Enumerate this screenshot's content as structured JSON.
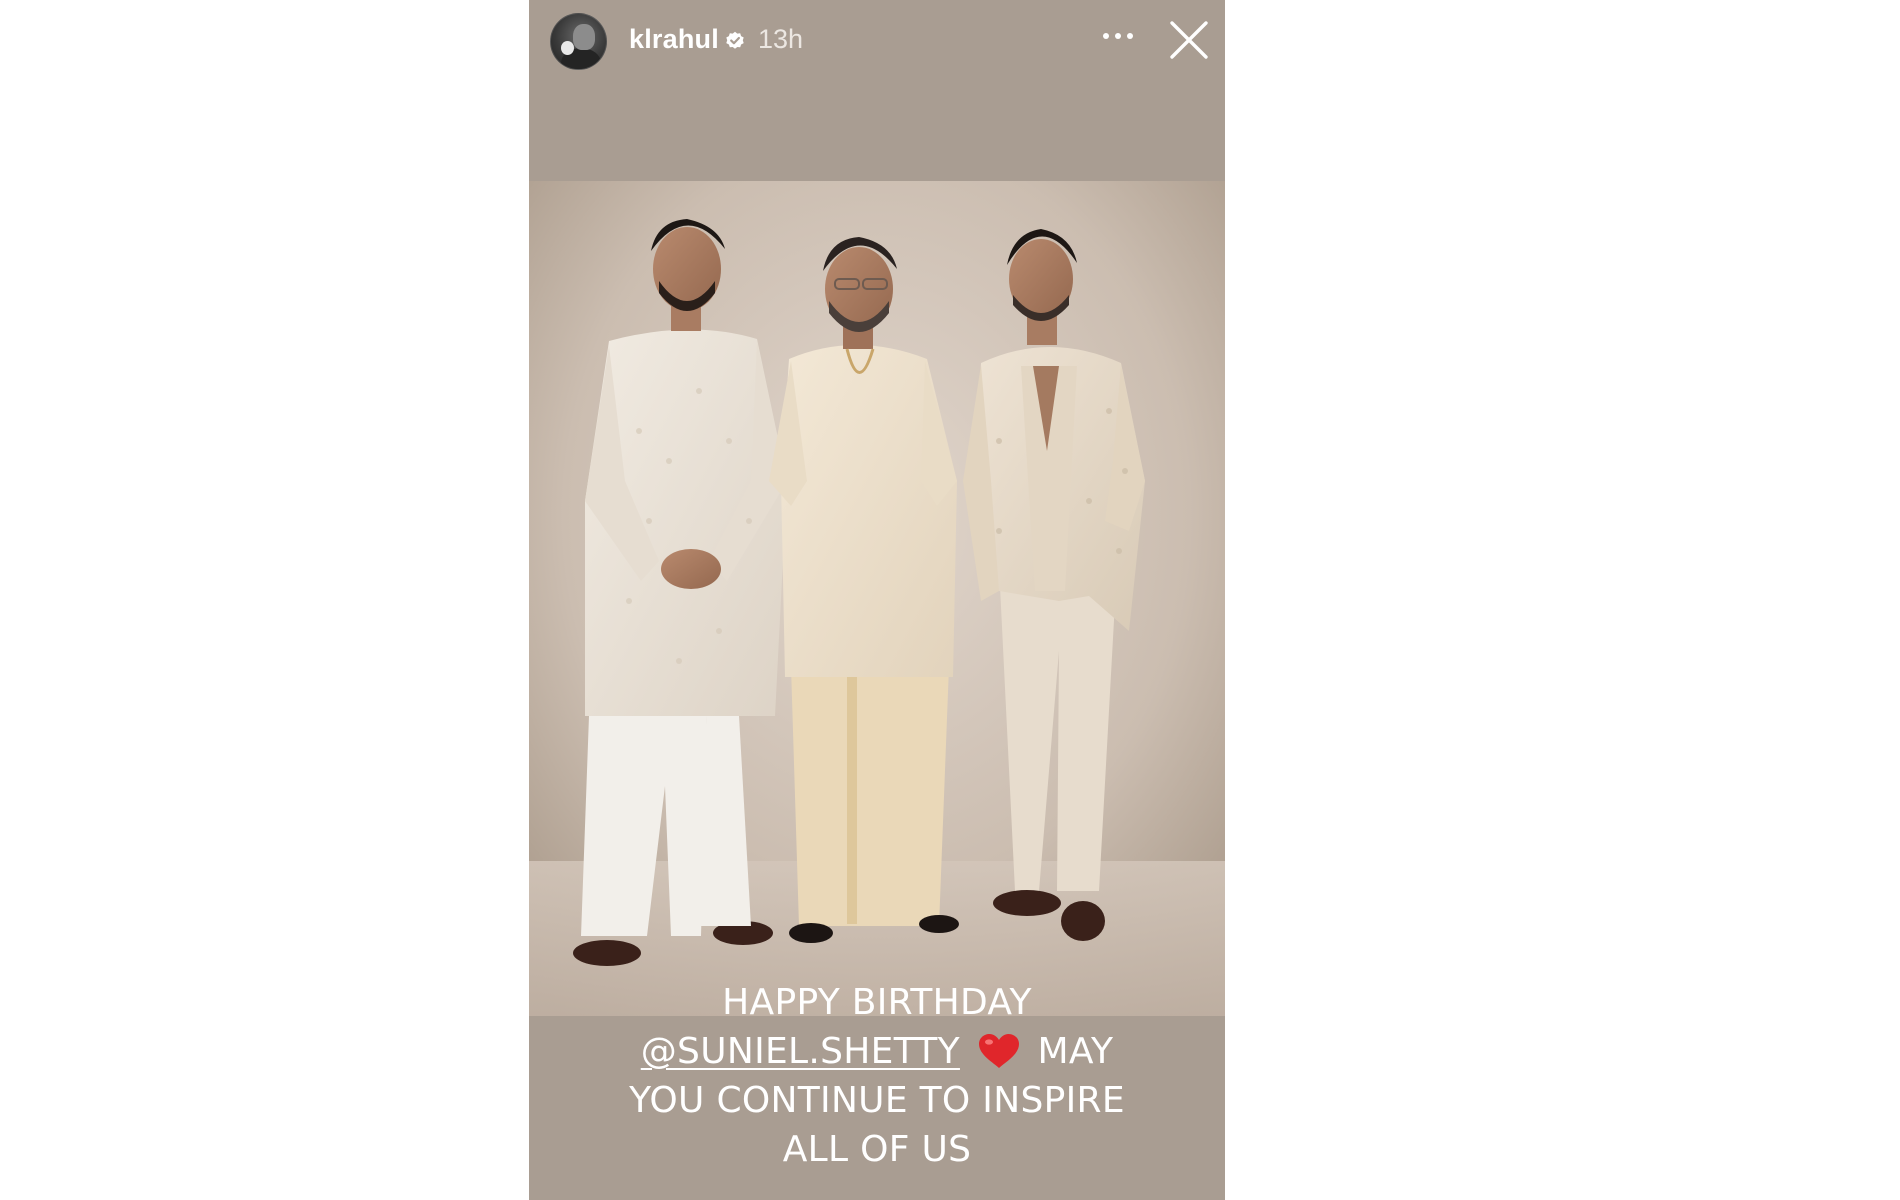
{
  "story": {
    "username": "klrahul",
    "verified": true,
    "timestamp": "13h",
    "icons": {
      "verified": "verified-badge-icon",
      "more": "more-options-icon",
      "close": "close-icon",
      "heart": "red-heart-emoji"
    },
    "caption": {
      "line1": "HAPPY BIRTHDAY",
      "mention": "@SUNIEL.SHETTY",
      "after_heart": "MAY",
      "line3": "YOU CONTINUE TO INSPIRE",
      "line4": "ALL OF US"
    },
    "colors": {
      "background": "#a99d92",
      "text": "#ffffff",
      "heart": "#e0262b",
      "verified_badge": "#ffffff"
    }
  }
}
